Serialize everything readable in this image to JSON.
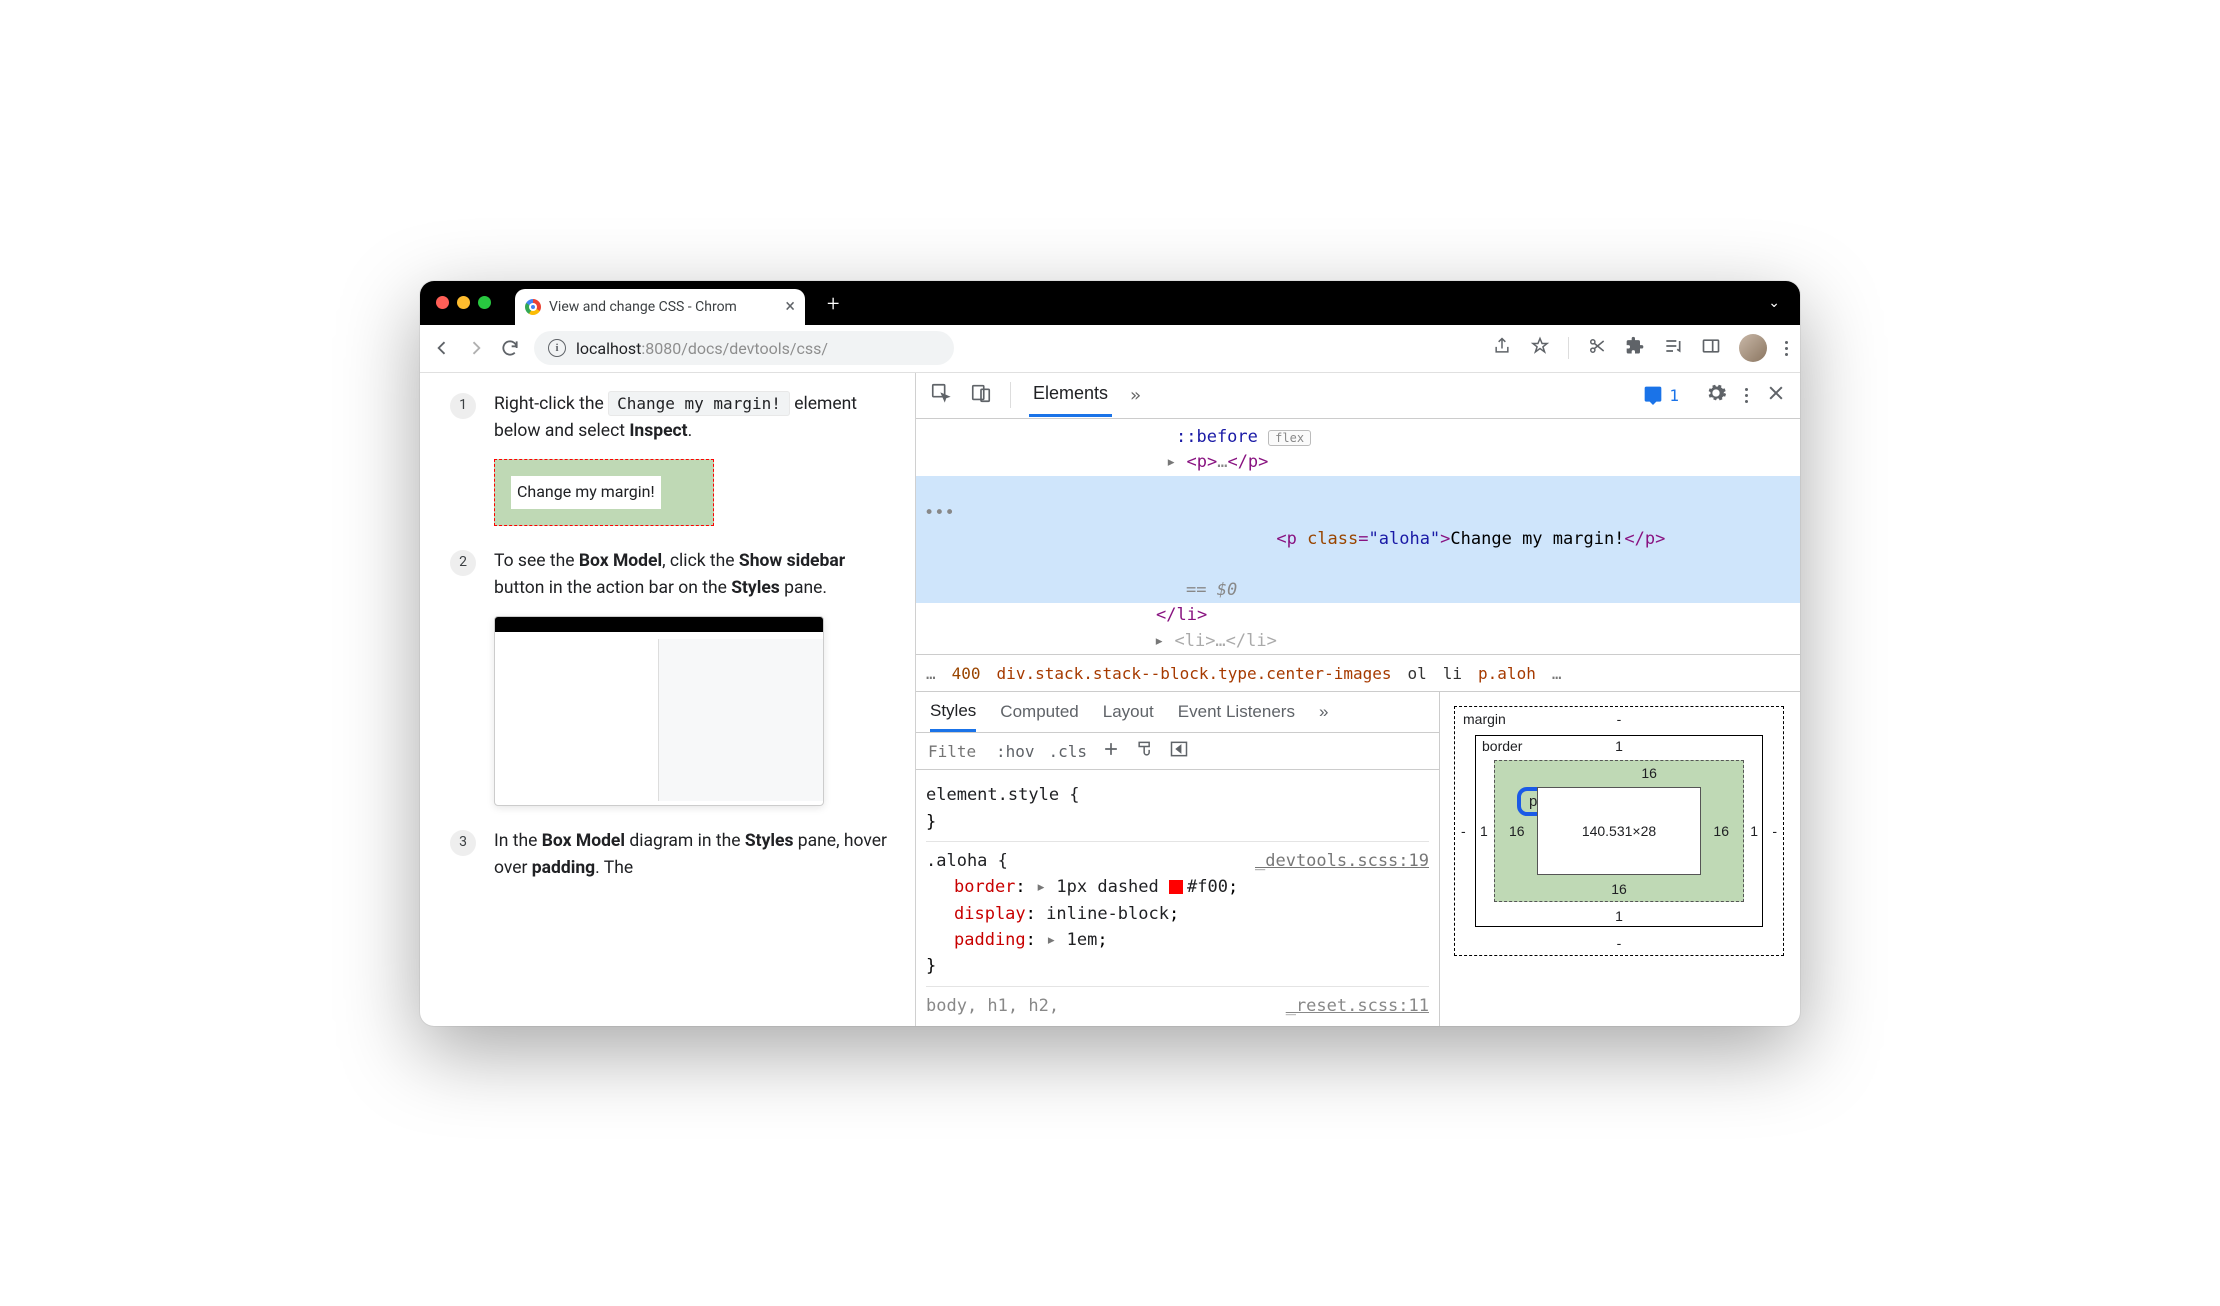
{
  "window": {
    "tab_title": "View and change CSS - Chrom"
  },
  "address": {
    "host": "localhost",
    "port_path": ":8080/docs/devtools/css/"
  },
  "page": {
    "step1_pre": "Right-click the ",
    "step1_code": "Change my margin!",
    "step1_post": " element below and select ",
    "step1_bold": "Inspect",
    "step1_end": ".",
    "demo_text": "Change my margin!",
    "step2_a": "To see the ",
    "step2_b": "Box Model",
    "step2_c": ", click the ",
    "step2_d": "Show sidebar",
    "step2_e": " button in the action bar on the ",
    "step2_f": "Styles",
    "step2_g": " pane.",
    "step3_a": "In the ",
    "step3_b": "Box Model",
    "step3_c": " diagram in the ",
    "step3_d": "Styles",
    "step3_e": " pane, hover over ",
    "step3_f": "padding",
    "step3_g": ". The"
  },
  "devtools": {
    "panel": "Elements",
    "issues_count": "1",
    "dom_before": "::before",
    "dom_flex": "flex",
    "dom_p_collapsed": "<p>…</p>",
    "dom_sel_open": "<p ",
    "dom_sel_attrn": "class",
    "dom_sel_attrv": "\"aloha\"",
    "dom_sel_text": "Change my margin!",
    "dom_sel_close": "</p>",
    "dom_eq": "== $0",
    "dom_li_close": "</li>",
    "breadcrumbs": {
      "ov1": "…",
      "c400": "400",
      "mid": "div.stack.stack--block.type.center-images",
      "ol": "ol",
      "li": "li",
      "paloh": "p.aloh",
      "ov2": "…"
    },
    "styles_tabs": {
      "styles": "Styles",
      "computed": "Computed",
      "layout": "Layout",
      "ev": "Event Listeners"
    },
    "filter_placeholder": "Filte",
    "hov": ":hov",
    "cls": ".cls",
    "rule_element": "element.style {",
    "rule_element_close": "}",
    "rule_aloha_sel": ".aloha {",
    "rule_aloha_src": "_devtools.scss:19",
    "rule_border_p": "border",
    "rule_border_v": "1px dashed ",
    "rule_border_hex": "#f00",
    "rule_display_p": "display",
    "rule_display_v": "inline-block",
    "rule_padding_p": "padding",
    "rule_padding_v": "1em",
    "rule_close": "}",
    "rule_body": "body, h1, h2,",
    "rule_body_src": "_reset.scss:11"
  },
  "boxmodel": {
    "margin_label": "margin",
    "border_label": "border",
    "padding_label": "padding",
    "content": "140.531×28",
    "margin_top": "-",
    "margin_right": "-",
    "margin_bottom": "-",
    "margin_left": "-",
    "border_top": "1",
    "border_right": "1",
    "border_bottom": "1",
    "border_left": "1",
    "pad_top": "16",
    "pad_right": "16",
    "pad_bottom": "16",
    "pad_left": "16"
  }
}
